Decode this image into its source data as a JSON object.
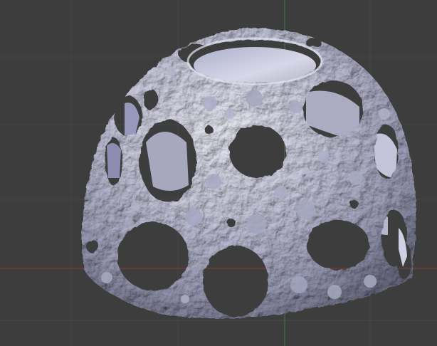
{
  "viewport": {
    "background": "#3d3d3d",
    "grid_color": "#454545",
    "x_axis_color": "#8a3a3a",
    "y_axis_color": "#3f7a3f",
    "mesh_base_color": "#c9cadf",
    "mesh_shadow_color": "#6e6f86",
    "mesh_highlight_color": "#f1f1fb",
    "hole_color": "#3d3d3d"
  },
  "scene": {
    "object": "dome-mesh",
    "shading": "solid",
    "holes": 20,
    "surface": "sculpted-bumpy"
  }
}
